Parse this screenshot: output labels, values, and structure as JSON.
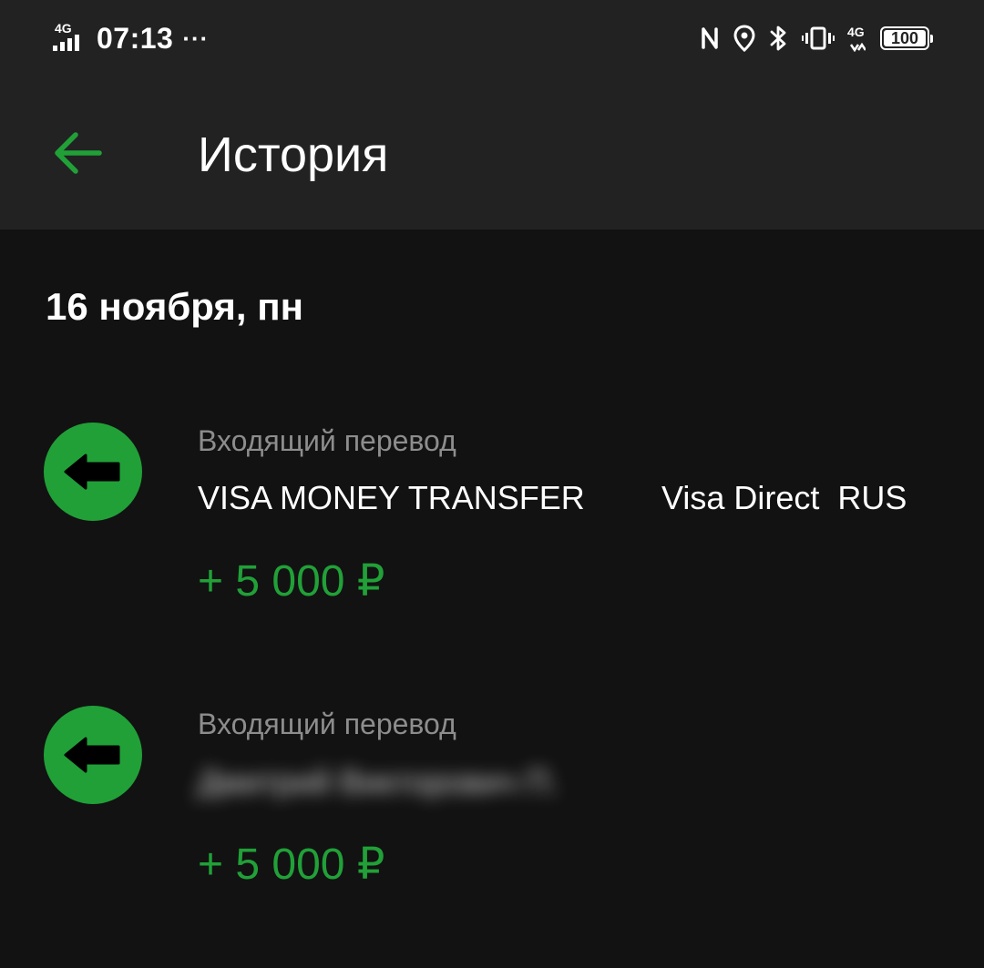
{
  "status_bar": {
    "network_left": "4G",
    "time": "07:13",
    "dots": "···",
    "network_right": "4G",
    "battery": "100",
    "icons": [
      "nfc-icon",
      "location-icon",
      "bluetooth-icon",
      "vibrate-icon",
      "signal-4g-icon",
      "battery-icon"
    ]
  },
  "header": {
    "back_icon": "arrow-left-icon",
    "title": "История"
  },
  "colors": {
    "accent": "#21a038",
    "background": "#121212",
    "header_background": "#222222",
    "secondary_text": "#8d8d8d"
  },
  "history": {
    "date": "16 ноября, пн",
    "transactions": [
      {
        "icon": "incoming-arrow-icon",
        "type": "Входящий перевод",
        "name": "VISA MONEY TRANSFER",
        "name_right": "Visa Direct  RUS",
        "amount": "+ 5 000 ₽"
      },
      {
        "icon": "incoming-arrow-icon",
        "type": "Входящий перевод",
        "name": "Дмитрий Викторович П.",
        "amount": "+ 5 000 ₽"
      }
    ]
  }
}
